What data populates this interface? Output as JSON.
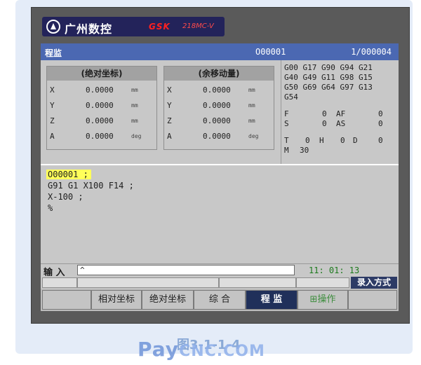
{
  "brand": {
    "logo_text": "广州数控",
    "gsk_mark": "GSK",
    "model": "218MC-V"
  },
  "screen": {
    "title": "程监",
    "program_no": "O00001",
    "sequence": "1/000004"
  },
  "absolute_coords": {
    "title": "(绝对坐标)",
    "rows": [
      {
        "axis": "X",
        "value": "0.0000",
        "unit": "mm"
      },
      {
        "axis": "Y",
        "value": "0.0000",
        "unit": "mm"
      },
      {
        "axis": "Z",
        "value": "0.0000",
        "unit": "mm"
      },
      {
        "axis": "A",
        "value": "0.0000",
        "unit": "deg"
      }
    ]
  },
  "remaining_coords": {
    "title": "(余移动量)",
    "rows": [
      {
        "axis": "X",
        "value": "0.0000",
        "unit": "mm"
      },
      {
        "axis": "Y",
        "value": "0.0000",
        "unit": "mm"
      },
      {
        "axis": "Z",
        "value": "0.0000",
        "unit": "mm"
      },
      {
        "axis": "A",
        "value": "0.0000",
        "unit": "deg"
      }
    ]
  },
  "modal_gcodes": {
    "lines": [
      "G00 G17 G90 G94 G21",
      "G40 G49 G11 G98 G15",
      "G50 G69 G64 G97 G13",
      "G54"
    ],
    "f_label": "F",
    "f_value": "0",
    "af_label": "AF",
    "af_value": "0",
    "s_label": "S",
    "s_value": "0",
    "as_label": "AS",
    "as_value": "0",
    "t_label": "T",
    "t_value": "0",
    "h_label": "H",
    "h_value": "0",
    "d_label": "D",
    "d_value": "0",
    "m_label": "M",
    "m_value": "30"
  },
  "program": {
    "lines": [
      "O00001 ;",
      "G91 G1 X100 F14 ;",
      "X-100 ;",
      "%"
    ]
  },
  "input": {
    "label": "输 入",
    "value": "^",
    "clock": "11: 01: 13"
  },
  "status": {
    "mode": "录入方式"
  },
  "softkeys": [
    {
      "label": "相对坐标"
    },
    {
      "label": "绝对坐标"
    },
    {
      "label": "综 合"
    },
    {
      "label": "程 监"
    },
    {
      "label": "⊞操作"
    }
  ],
  "caption": {
    "figure": "图3-1-1-4",
    "watermark_main": "Pay",
    "watermark_sub": "CNC.COM"
  },
  "colors": {
    "title_bar": "#4b68b2",
    "highlight": "#ffff5a",
    "active_key": "#20305a",
    "clock": "#1d7a1d"
  }
}
